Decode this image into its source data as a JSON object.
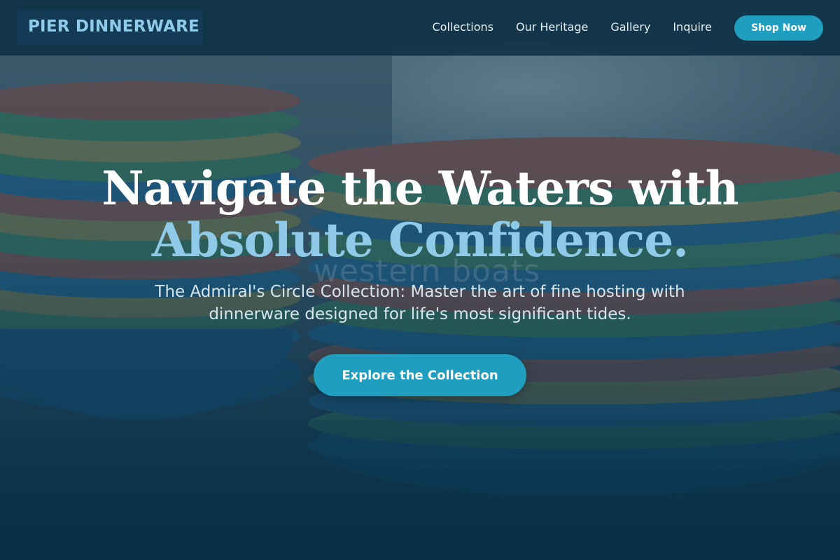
{
  "nav": {
    "logo": "PIER DINNERWARE",
    "links": [
      "Collections",
      "Our Heritage",
      "Gallery",
      "Inquire"
    ],
    "cta_label": "Shop Now"
  },
  "hero": {
    "headline_line1": "Navigate the Waters with",
    "headline_line2": "Absolute Confidence.",
    "subtitle": "The Admiral's Circle Collection: Master the art of fine hosting with dinnerware designed for life's most significant tides.",
    "cta_label": "Explore the Collection",
    "background_watermark": "western boats"
  },
  "colors": {
    "accent": "#1f9ec0",
    "logo_text": "#8fcbe8",
    "overlay": "#0a344e",
    "headline_white": "#ffffff"
  }
}
